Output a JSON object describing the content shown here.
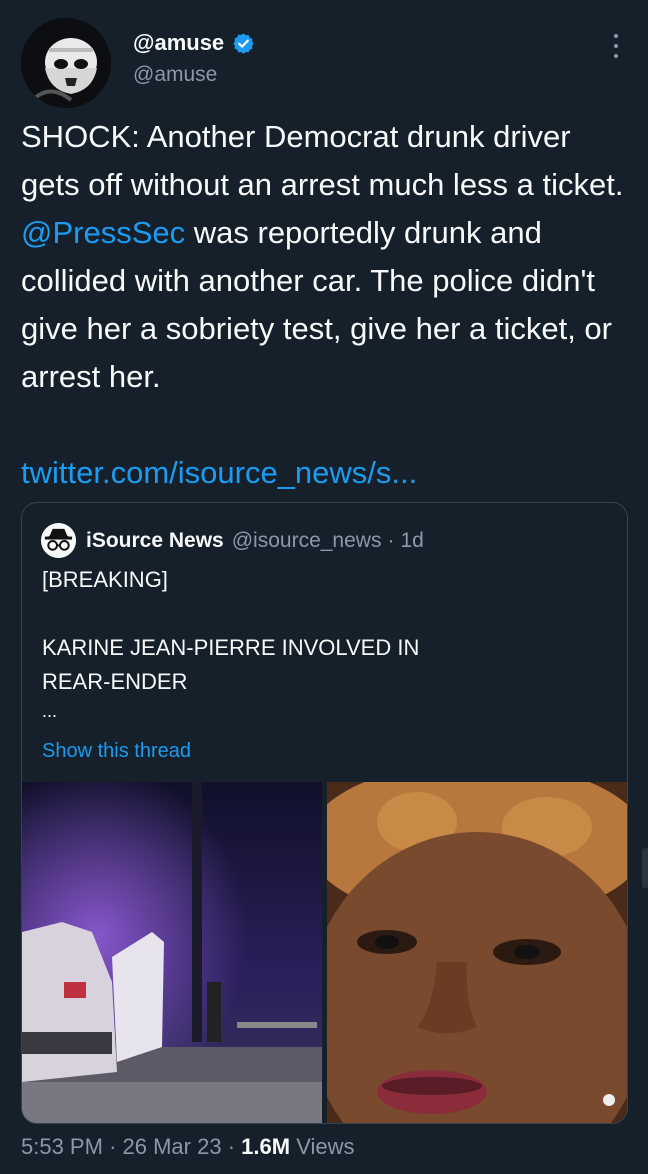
{
  "author": {
    "display_name": "@amuse",
    "handle": "@amuse",
    "verified": true
  },
  "tweet": {
    "text_before_mention": "SHOCK: Another Democrat drunk driver gets off without an arrest much less a ticket. ",
    "mention": "@PressSec",
    "text_after_mention": " was reportedly drunk and collided with another car. The police didn't give her a sobriety test, give her a ticket, or arrest her.",
    "link": "twitter.com/isource_news/s..."
  },
  "quoted": {
    "name": "iSource News",
    "handle": "@isource_news",
    "separator": "·",
    "age": "1d",
    "line1": "[BREAKING]",
    "line2": "KARINE JEAN-PIERRE INVOLVED IN",
    "line3": "REAR-ENDER",
    "line4": "...",
    "show_thread": "Show this thread"
  },
  "footer": {
    "time": "5:53 PM",
    "dot1": "·",
    "date": "26 Mar 23",
    "dot2": "·",
    "views_count": "1.6M",
    "views_label": "Views"
  },
  "colors": {
    "background": "#15202b",
    "accent": "#1d9bf0",
    "muted": "#8b98a5",
    "border": "#38444d"
  }
}
